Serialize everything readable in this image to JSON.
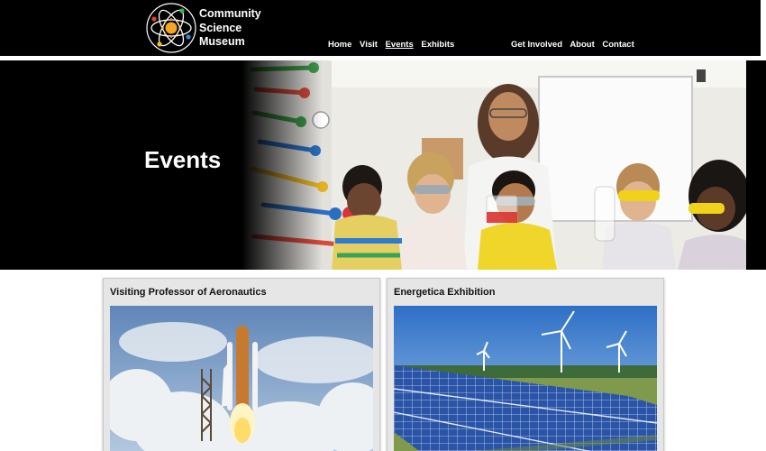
{
  "site": {
    "brand_lines": [
      "Community",
      "Science",
      "Museum"
    ],
    "logo_icon": "atom-sun-icon"
  },
  "nav": {
    "main": [
      "Home",
      "Visit",
      "Events",
      "Exhibits"
    ],
    "secondary": [
      "Get Involved",
      "About",
      "Contact"
    ],
    "active": "Events"
  },
  "hero": {
    "title": "Events",
    "image": "classroom-science-lab-photo"
  },
  "cards": [
    {
      "title": "Visiting Professor of Aeronautics",
      "image": "rocket-launch-photo"
    },
    {
      "title": "Energetica Exhibition",
      "image": "solar-panels-wind-turbines-photo"
    }
  ]
}
